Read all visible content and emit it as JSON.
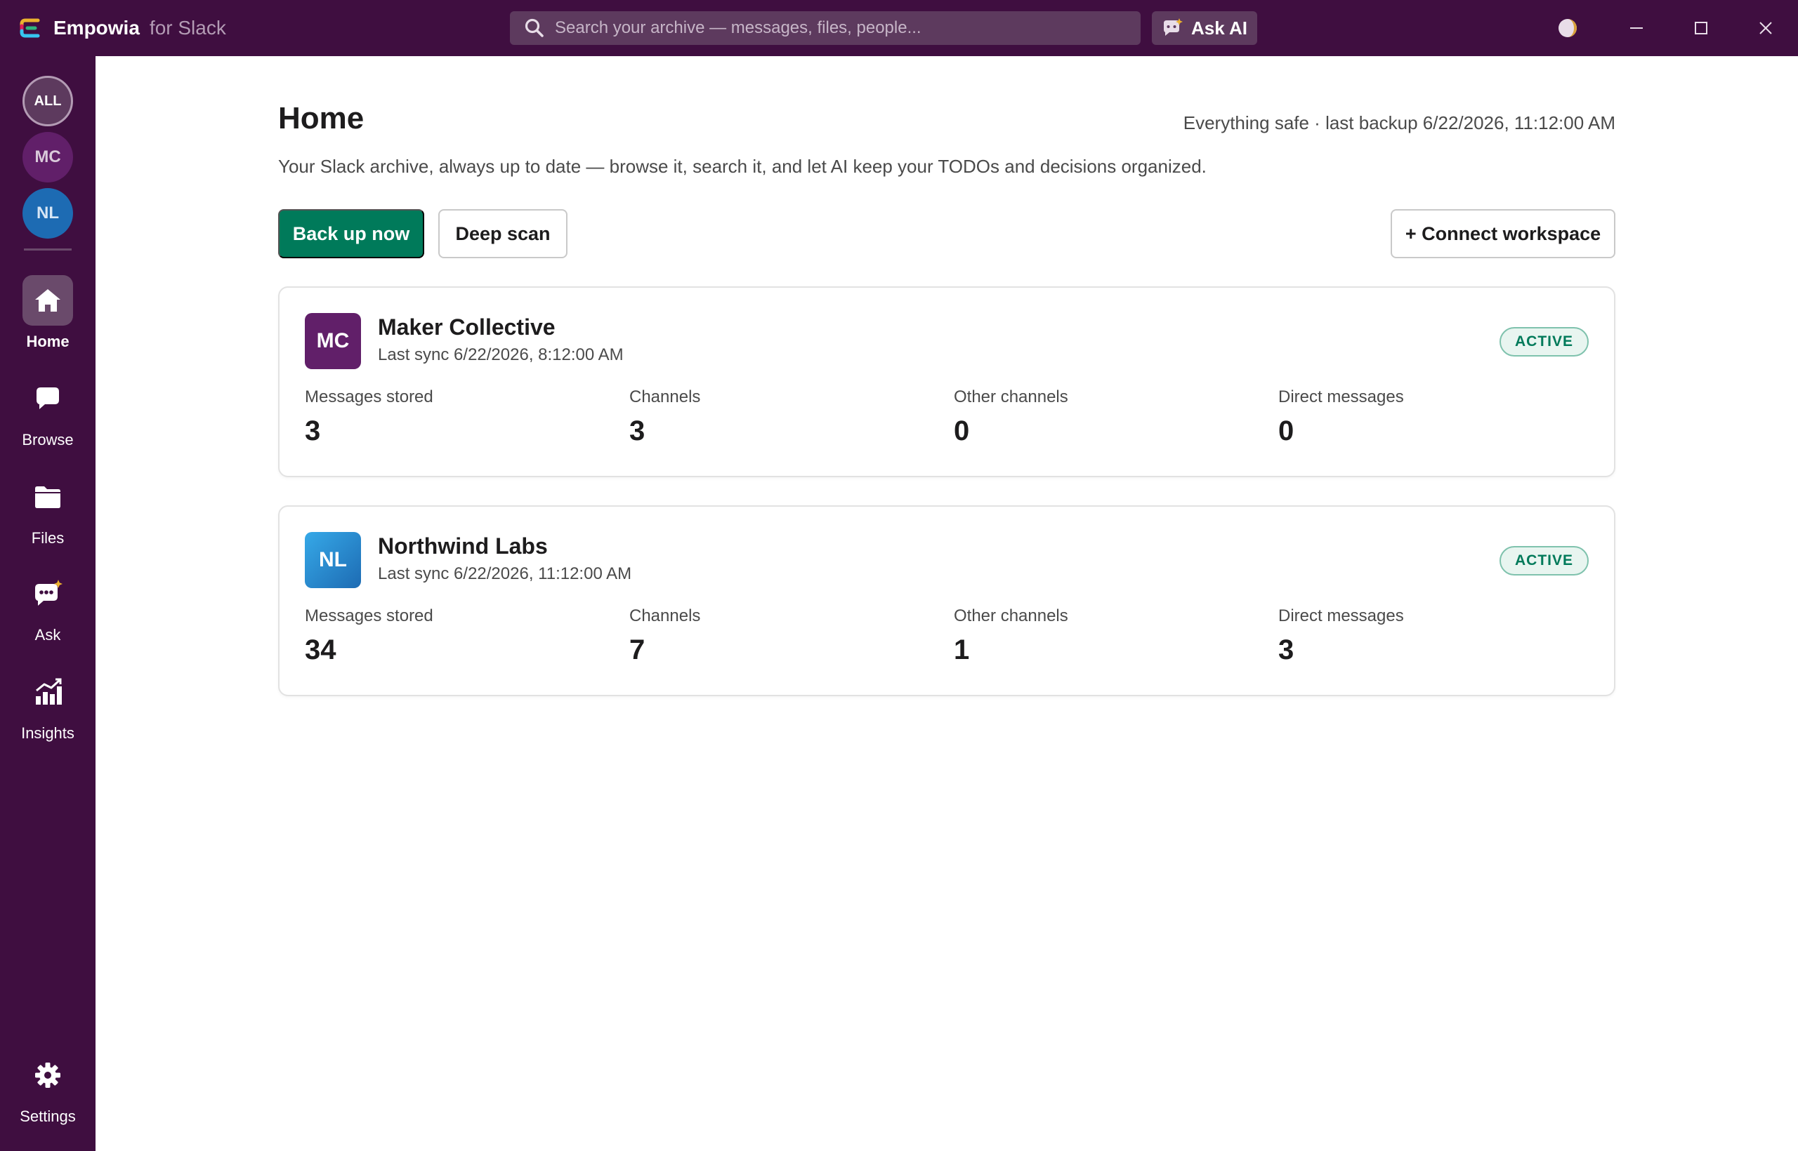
{
  "app": {
    "name": "Empowia",
    "subtitle": "for Slack"
  },
  "header": {
    "search_placeholder": "Search your archive — messages, files, people...",
    "ask_ai_label": "Ask AI"
  },
  "rail": {
    "workspaces": [
      {
        "label": "ALL",
        "color": "#5d3a5e"
      },
      {
        "label": "MC",
        "color": "#611f69"
      },
      {
        "label": "NL",
        "color": "#1d6bb3"
      }
    ],
    "nav": [
      {
        "label": "Home",
        "icon": "home-icon",
        "active": true
      },
      {
        "label": "Browse",
        "icon": "chat-bubble-icon",
        "active": false
      },
      {
        "label": "Files",
        "icon": "folder-icon",
        "active": false
      },
      {
        "label": "Ask",
        "icon": "ai-chat-icon",
        "active": false
      },
      {
        "label": "Insights",
        "icon": "chart-icon",
        "active": false
      }
    ],
    "settings_label": "Settings"
  },
  "main": {
    "title": "Home",
    "backup_status": "Everything safe · last backup 6/22/2026, 11:12:00 AM",
    "subtitle": "Your Slack archive, always up to date — browse it, search it, and let AI keep your TODOs and decisions organized.",
    "buttons": {
      "backup_now": "Back up now",
      "deep_scan": "Deep scan",
      "connect": "+ Connect workspace"
    },
    "stat_labels": {
      "messages": "Messages stored",
      "channels": "Channels",
      "other_channels": "Other channels",
      "direct_messages": "Direct messages"
    },
    "workspaces": [
      {
        "initials": "MC",
        "name": "Maker Collective",
        "last_sync": "Last sync 6/22/2026, 8:12:00 AM",
        "status": "ACTIVE",
        "messages": "3",
        "channels": "3",
        "other_channels": "0",
        "direct_messages": "0",
        "color": "#611f69"
      },
      {
        "initials": "NL",
        "name": "Northwind Labs",
        "last_sync": "Last sync 6/22/2026, 11:12:00 AM",
        "status": "ACTIVE",
        "messages": "34",
        "channels": "7",
        "other_channels": "1",
        "direct_messages": "3",
        "color": "#1d8fd6"
      }
    ]
  },
  "colors": {
    "sidebar": "#3f0e40",
    "accent_green": "#007a5a"
  }
}
